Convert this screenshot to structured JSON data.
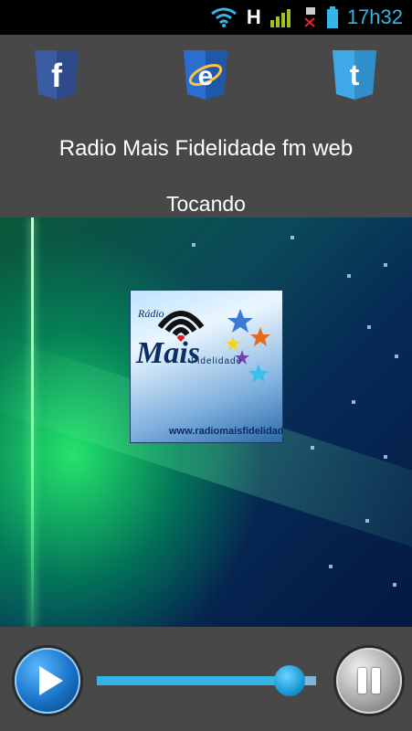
{
  "status_bar": {
    "time": "17h32",
    "network": "H",
    "icons": [
      "wifi-icon",
      "signal-icon",
      "no-sim-icon",
      "battery-icon"
    ],
    "accent": "#33b5e5"
  },
  "social": {
    "facebook_letter": "f",
    "browser_letter": "e",
    "twitter_letter": "t",
    "facebook_color": "#3b5ba3",
    "browser_color": "#2a6fd0",
    "twitter_color": "#3fa9e8"
  },
  "header": {
    "title": "Radio Mais Fidelidade fm web",
    "status": "Tocando"
  },
  "artwork": {
    "radio_text": "Rádio",
    "mais_text": "Mais",
    "fidelidade_text": "Fidelidade",
    "url_text": "www.radiomaisfidelidade.net"
  },
  "player": {
    "volume_fraction": 0.88,
    "play_color": "#1a73c8",
    "track_color": "#33b5e5"
  }
}
